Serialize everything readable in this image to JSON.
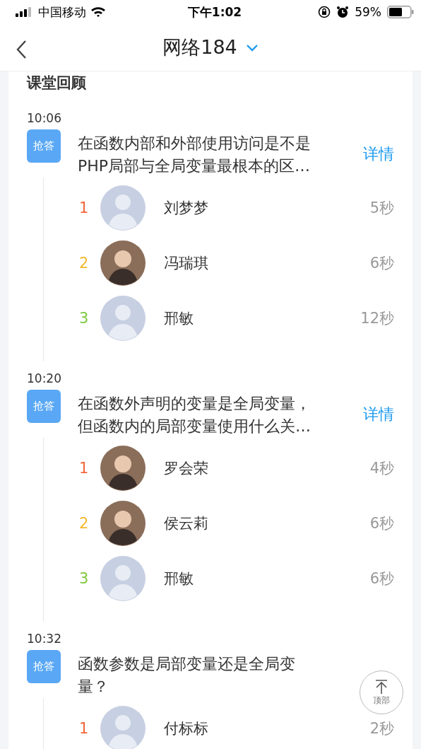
{
  "status_bar": {
    "carrier": "中国移动",
    "time": "下午1:02",
    "battery": "59%"
  },
  "header": {
    "title": "网络184"
  },
  "card": {
    "title": "课堂回顾"
  },
  "sessions": [
    {
      "time": "10:06",
      "badge": "抢答",
      "question": "在函数内部和外部使用访问是不是PHP局部与全局变量最根本的区…",
      "details": "详情",
      "answers": [
        {
          "rank": "1",
          "kind": "default",
          "name": "刘梦梦",
          "duration": "5秒"
        },
        {
          "rank": "2",
          "kind": "photo",
          "name": "冯瑞琪",
          "duration": "6秒"
        },
        {
          "rank": "3",
          "kind": "default",
          "name": "邢敏",
          "duration": "12秒"
        }
      ]
    },
    {
      "time": "10:20",
      "badge": "抢答",
      "question": "在函数外声明的变量是全局变量，但函数内的局部变量使用什么关…",
      "details": "详情",
      "answers": [
        {
          "rank": "1",
          "kind": "photo",
          "name": "罗会荣",
          "duration": "4秒"
        },
        {
          "rank": "2",
          "kind": "photo",
          "name": "侯云莉",
          "duration": "6秒"
        },
        {
          "rank": "3",
          "kind": "default",
          "name": "邢敏",
          "duration": "6秒"
        }
      ]
    },
    {
      "time": "10:32",
      "badge": "抢答",
      "question": "函数参数是局部变量还是全局变量？",
      "answers": [
        {
          "rank": "1",
          "kind": "default",
          "name": "付标标",
          "duration": "2秒"
        }
      ]
    }
  ],
  "back_to_top": {
    "label": "顶部"
  }
}
